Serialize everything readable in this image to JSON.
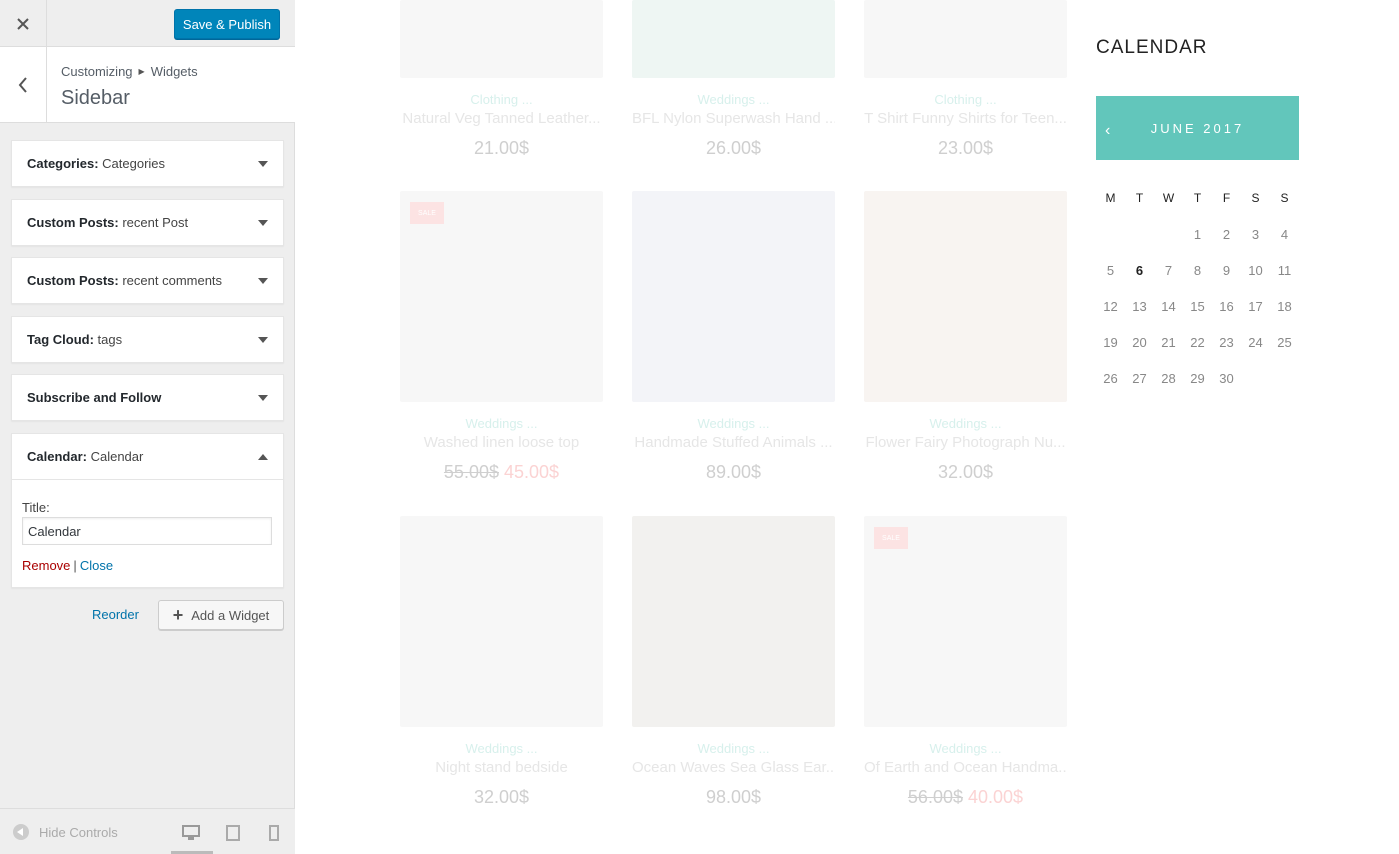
{
  "customizer": {
    "publish_label": "Save & Publish",
    "breadcrumb": [
      "Customizing",
      "Widgets"
    ],
    "section_title": "Sidebar",
    "widgets": [
      {
        "name": "Categories:",
        "instance": " Categories"
      },
      {
        "name": "Custom Posts:",
        "instance": " recent Post"
      },
      {
        "name": "Custom Posts:",
        "instance": " recent comments"
      },
      {
        "name": "Tag Cloud:",
        "instance": " tags"
      },
      {
        "name": "Subscribe and Follow",
        "instance": ""
      },
      {
        "name": "Calendar:",
        "instance": " Calendar"
      }
    ],
    "calendar_form": {
      "title_label": "Title:",
      "title_value": "Calendar",
      "remove_label": "Remove",
      "separator": "|",
      "close_label": "Close"
    },
    "reorder_label": "Reorder",
    "add_widget_label": "Add a Widget",
    "hide_controls_label": "Hide Controls"
  },
  "preview": {
    "products": [
      {
        "category": "Clothing ...",
        "name": "Natural Veg Tanned Leather...",
        "price": "21.00$"
      },
      {
        "category": "Weddings ...",
        "name": "BFL Nylon Superwash Hand ...",
        "price": "26.00$"
      },
      {
        "category": "Clothing ...",
        "name": "T Shirt Funny Shirts for Teen...",
        "price": "23.00$"
      },
      {
        "category": "Weddings ...",
        "name": "Washed linen loose top",
        "old_price": "55.00$",
        "price": "45.00$",
        "sale": "SALE"
      },
      {
        "category": "Weddings ...",
        "name": "Handmade Stuffed Animals ...",
        "price": "89.00$"
      },
      {
        "category": "Weddings ...",
        "name": "Flower Fairy Photograph Nu...",
        "price": "32.00$"
      },
      {
        "category": "Weddings ...",
        "name": "Night stand bedside",
        "price": "32.00$"
      },
      {
        "category": "Weddings ...",
        "name": "Ocean Waves Sea Glass Ear...",
        "price": "98.00$"
      },
      {
        "category": "Weddings ...",
        "name": "Of Earth and Ocean Handma...",
        "old_price": "56.00$",
        "price": "40.00$",
        "sale": "SALE"
      }
    ],
    "calendar": {
      "heading": "CALENDAR",
      "month": "JUNE 2017",
      "prev": "‹",
      "days_of_week": [
        "M",
        "T",
        "W",
        "T",
        "F",
        "S",
        "S"
      ],
      "weeks": [
        [
          "",
          "",
          "",
          "1",
          "2",
          "3",
          "4"
        ],
        [
          "5",
          "6",
          "7",
          "8",
          "9",
          "10",
          "11"
        ],
        [
          "12",
          "13",
          "14",
          "15",
          "16",
          "17",
          "18"
        ],
        [
          "19",
          "20",
          "21",
          "22",
          "23",
          "24",
          "25"
        ],
        [
          "26",
          "27",
          "28",
          "29",
          "30",
          "",
          ""
        ]
      ],
      "today": "6"
    }
  }
}
